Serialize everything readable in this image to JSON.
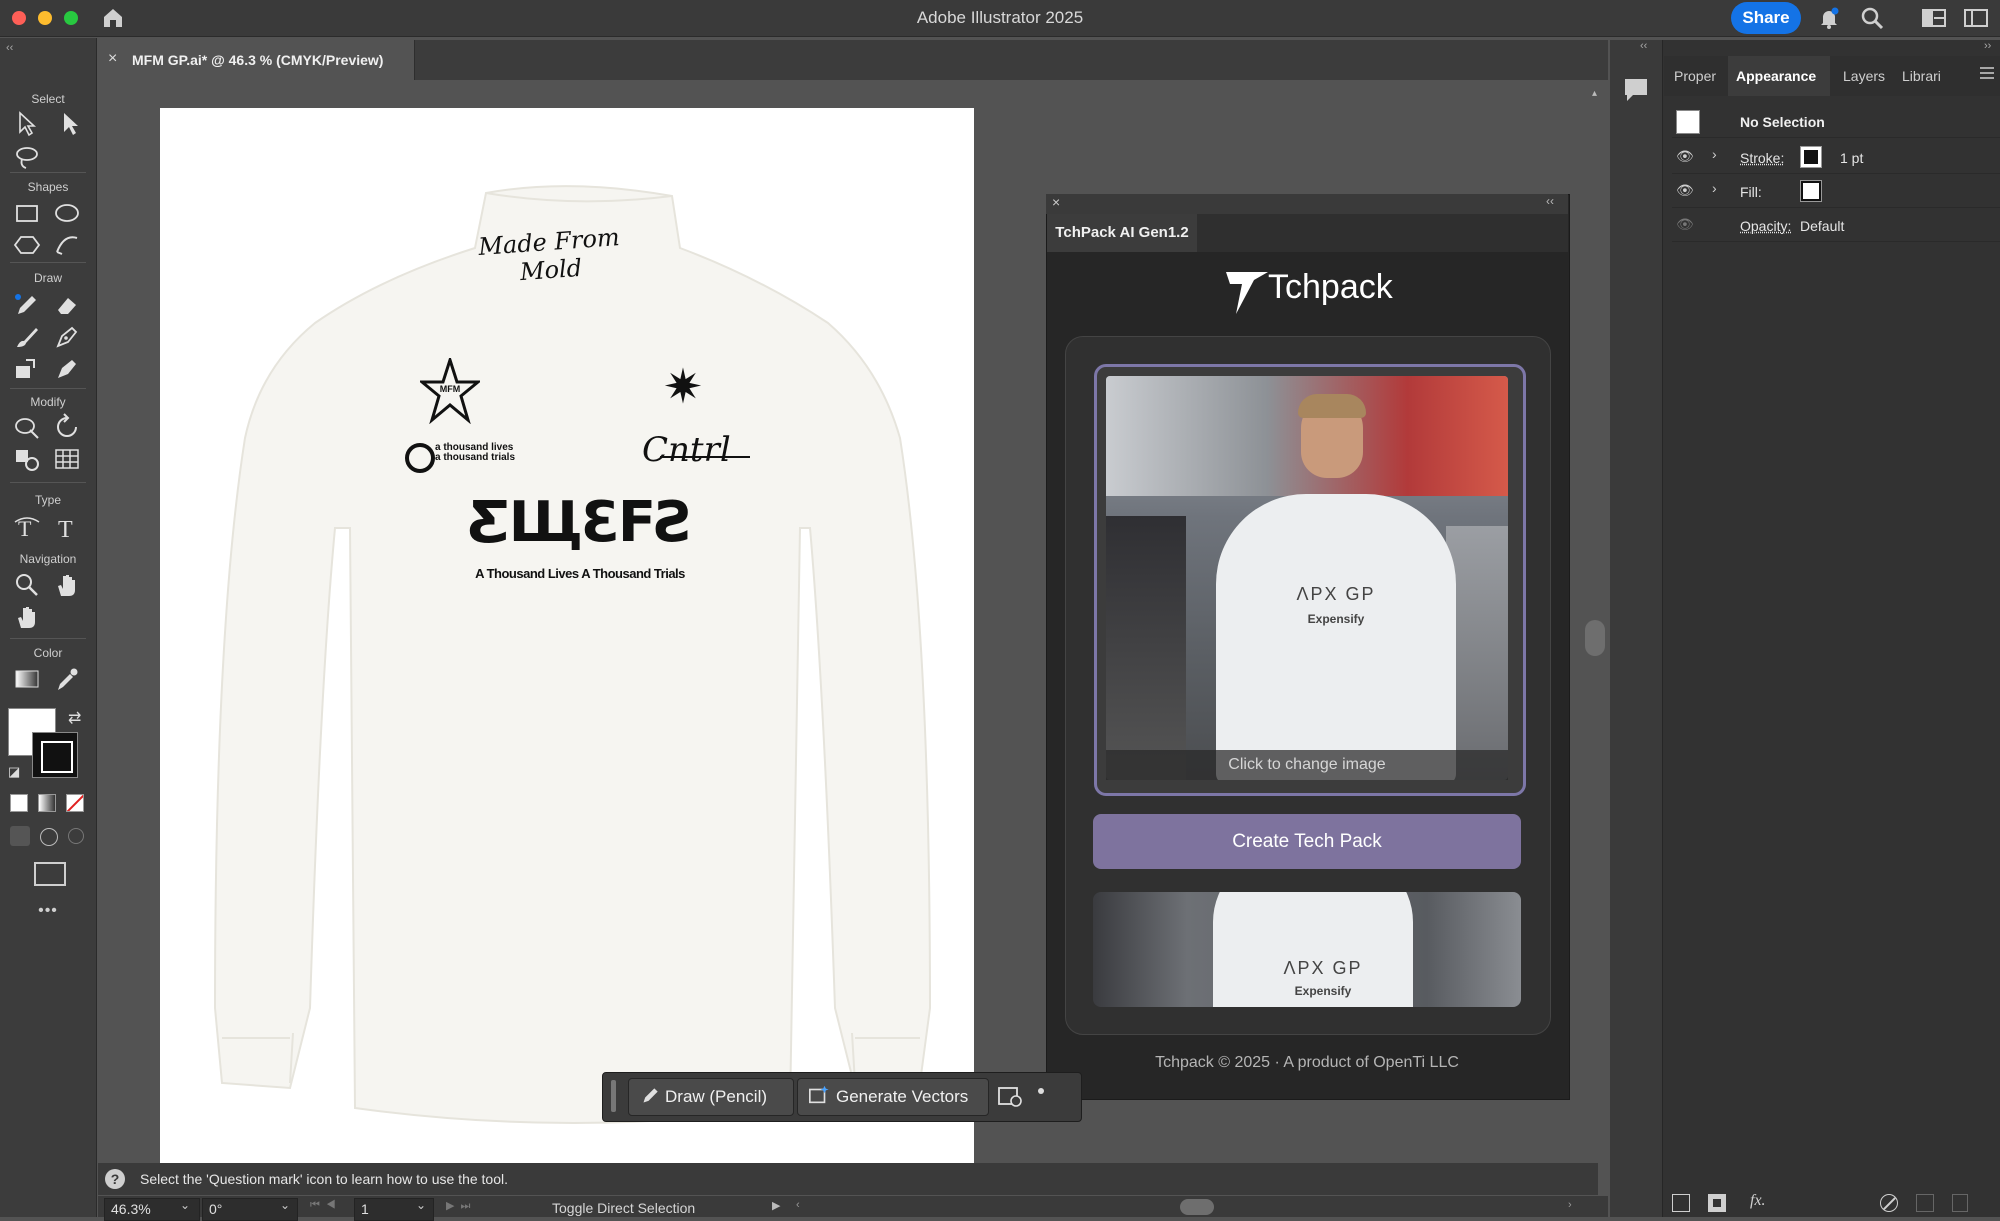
{
  "app": {
    "title": "Adobe Illustrator 2025",
    "share_label": "Share"
  },
  "document": {
    "tab_label": "MFM GP.ai* @ 46.3 % (CMYK/Preview)",
    "close_glyph": "×"
  },
  "toolbar": {
    "sections": {
      "select": "Select",
      "shapes": "Shapes",
      "draw": "Draw",
      "modify": "Modify",
      "type": "Type",
      "navigation": "Navigation",
      "color": "Color"
    },
    "more_glyph": "•••"
  },
  "artwork": {
    "collar_script": "Made From Mold",
    "star_logo": "MFM",
    "spider_logo": "✷",
    "brand_small_1": "a thousand lives",
    "brand_small_2": "a thousand trials",
    "signature": "Cntrl",
    "main_logo": "ƸЩƐFƧ",
    "tagline": "A Thousand Lives A Thousand Trials"
  },
  "tchpack": {
    "tab_label": "TchPack AI Gen1.2",
    "brand": "Tchpack",
    "image_caption": "Click to change image",
    "create_label": "Create Tech Pack",
    "footer": "Tchpack © 2025 · A product of OpenTi LLC",
    "shirt_brand": "ΛPX GP",
    "sponsor": "Expensify"
  },
  "right_panel": {
    "tabs": [
      "Proper",
      "Appearance",
      "Layers",
      "Librari"
    ],
    "active_tab": "Appearance",
    "selection": "No Selection",
    "stroke_label": "Stroke:",
    "stroke_value": "1 pt",
    "fill_label": "Fill:",
    "opacity_label": "Opacity:",
    "opacity_value": "Default"
  },
  "floating_bar": {
    "draw_label": "Draw (Pencil)",
    "generate_label": "Generate Vectors"
  },
  "hint": {
    "text": "Select the 'Question mark' icon to learn how to use the tool."
  },
  "status": {
    "zoom": "46.3%",
    "rotation": "0°",
    "artboard": "1",
    "tool": "Toggle Direct Selection"
  },
  "colors": {
    "accent": "#1473e6",
    "tp_button": "#7e739e",
    "tp_frame": "#7d77a8"
  }
}
